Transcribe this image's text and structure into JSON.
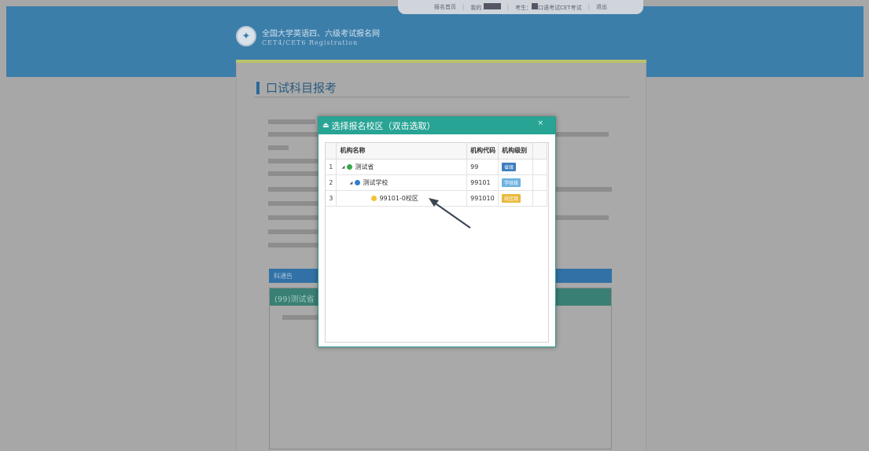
{
  "topbar": {
    "items": [
      "报名首页",
      "我的",
      "考生：",
      "口语考试CET考试",
      "退出"
    ]
  },
  "site": {
    "title": "全国大学英语四、六级考试报名网",
    "subtitle": "CET4/CET6  Registration"
  },
  "page": {
    "title": "口试科目报考",
    "blue_bar": "科通告",
    "province_bar": "(99)测试省"
  },
  "dialog": {
    "title": "选择报名校区（双击选取）",
    "close_label": "×",
    "columns": [
      "机构名称",
      "机构代码",
      "机构级别"
    ],
    "rows": [
      {
        "num": "1",
        "name": "测试省",
        "code": "99",
        "level": "省级",
        "dot_color": "#3aa84a",
        "level_color": "#3d7ec0",
        "expanded": true
      },
      {
        "num": "2",
        "name": "测试学校",
        "code": "99101",
        "level": "学校级",
        "dot_color": "#2d7fd0",
        "level_color": "#6db3e0",
        "expanded": true
      },
      {
        "num": "3",
        "name": "99101-0校区",
        "code": "991010",
        "level": "校区级",
        "dot_color": "#f2c230",
        "level_color": "#e8b93c",
        "expanded": false
      }
    ]
  },
  "colors": {
    "header": "#3c7eaa",
    "dialog_header": "#28a495"
  }
}
